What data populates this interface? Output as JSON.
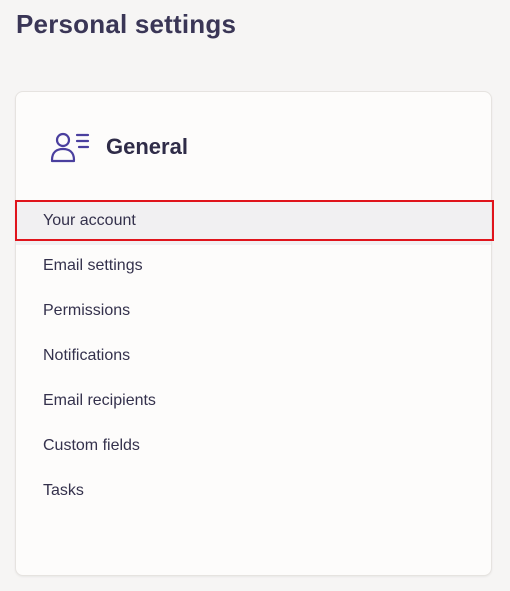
{
  "page": {
    "title": "Personal settings"
  },
  "card": {
    "icon": "user-list-icon",
    "title": "General",
    "accent_color": "#4a3f9e",
    "highlight_color": "#e0141c",
    "items": [
      {
        "label": "Your account",
        "selected": true
      },
      {
        "label": "Email settings"
      },
      {
        "label": "Permissions"
      },
      {
        "label": "Notifications"
      },
      {
        "label": "Email recipients"
      },
      {
        "label": "Custom fields"
      },
      {
        "label": "Tasks"
      }
    ]
  }
}
